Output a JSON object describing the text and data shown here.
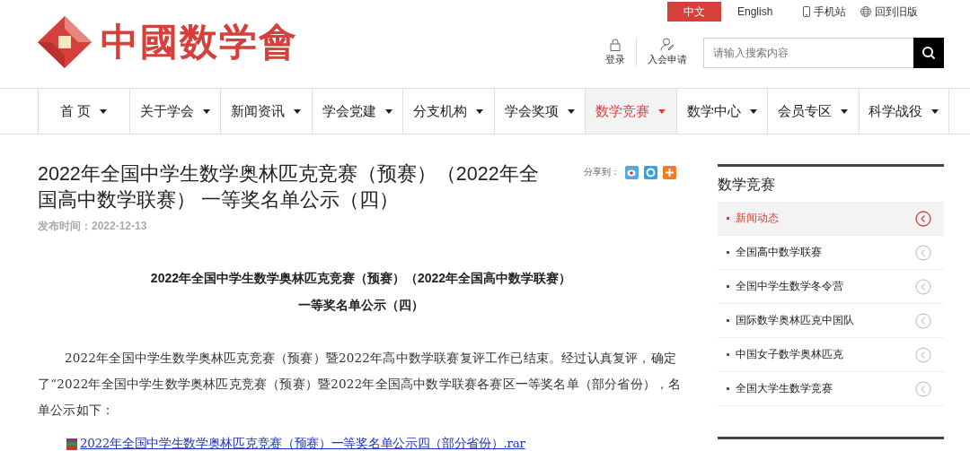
{
  "header": {
    "logo_text": "中國数学會",
    "languages": [
      {
        "label": "中文",
        "selected": true
      },
      {
        "label": "English",
        "selected": false
      }
    ],
    "top_links": [
      {
        "kind": "phone",
        "label": "手机站"
      },
      {
        "kind": "globe",
        "label": "回到旧版"
      }
    ],
    "user_links": [
      {
        "kind": "lock",
        "label": "登录"
      },
      {
        "kind": "person",
        "label": "入会申请"
      }
    ],
    "search": {
      "placeholder": "请输入搜索内容"
    }
  },
  "nav": [
    {
      "label": "首 页",
      "selected": false
    },
    {
      "label": "关于学会",
      "selected": false
    },
    {
      "label": "新闻资讯",
      "selected": false
    },
    {
      "label": "学会党建",
      "selected": false
    },
    {
      "label": "分支机构",
      "selected": false
    },
    {
      "label": "学会奖项",
      "selected": false
    },
    {
      "label": "数学竞赛",
      "selected": true
    },
    {
      "label": "数学中心",
      "selected": false
    },
    {
      "label": "会员专区",
      "selected": false
    },
    {
      "label": "科学战役",
      "selected": false
    }
  ],
  "article": {
    "title": "2022年全国中学生数学奥林匹克竞赛（预赛）（2022年全国高中数学联赛） 一等奖名单公示（四）",
    "share_label": "分享到：",
    "share_buttons": [
      {
        "kind": "weibo"
      },
      {
        "kind": "qq"
      },
      {
        "kind": "more"
      }
    ],
    "date": "发布时间：2022-12-13",
    "heading_lines": [
      "2022年全国中学生数学奥林匹克竞赛（预赛）（2022年全国高中数学联赛）",
      "一等奖名单公示（四）"
    ],
    "paragraph": "2022年全国中学生数学奥林匹克竞赛（预赛）暨2022年高中数学联赛复评工作已结束。经过认真复评，确定了“2022年全国中学生数学奥林匹克竞赛（预赛）暨2022年全国高中数学联赛各赛区一等奖名单（部分省份），名单公示如下：",
    "attachment": "2022年全国中学生数学奥林匹克竞赛（预赛）一等奖名单公示四（部分省份）.rar"
  },
  "sidebar": {
    "title": "数学竞赛",
    "items": [
      {
        "label": "新闻动态",
        "selected": true
      },
      {
        "label": "全国高中数学联赛",
        "selected": false
      },
      {
        "label": "全国中学生数学冬令营",
        "selected": false
      },
      {
        "label": "国际数学奥林匹克中国队",
        "selected": false
      },
      {
        "label": "中国女子数学奥林匹克",
        "selected": false
      },
      {
        "label": "全国大学生数学竞赛",
        "selected": false
      }
    ]
  }
}
